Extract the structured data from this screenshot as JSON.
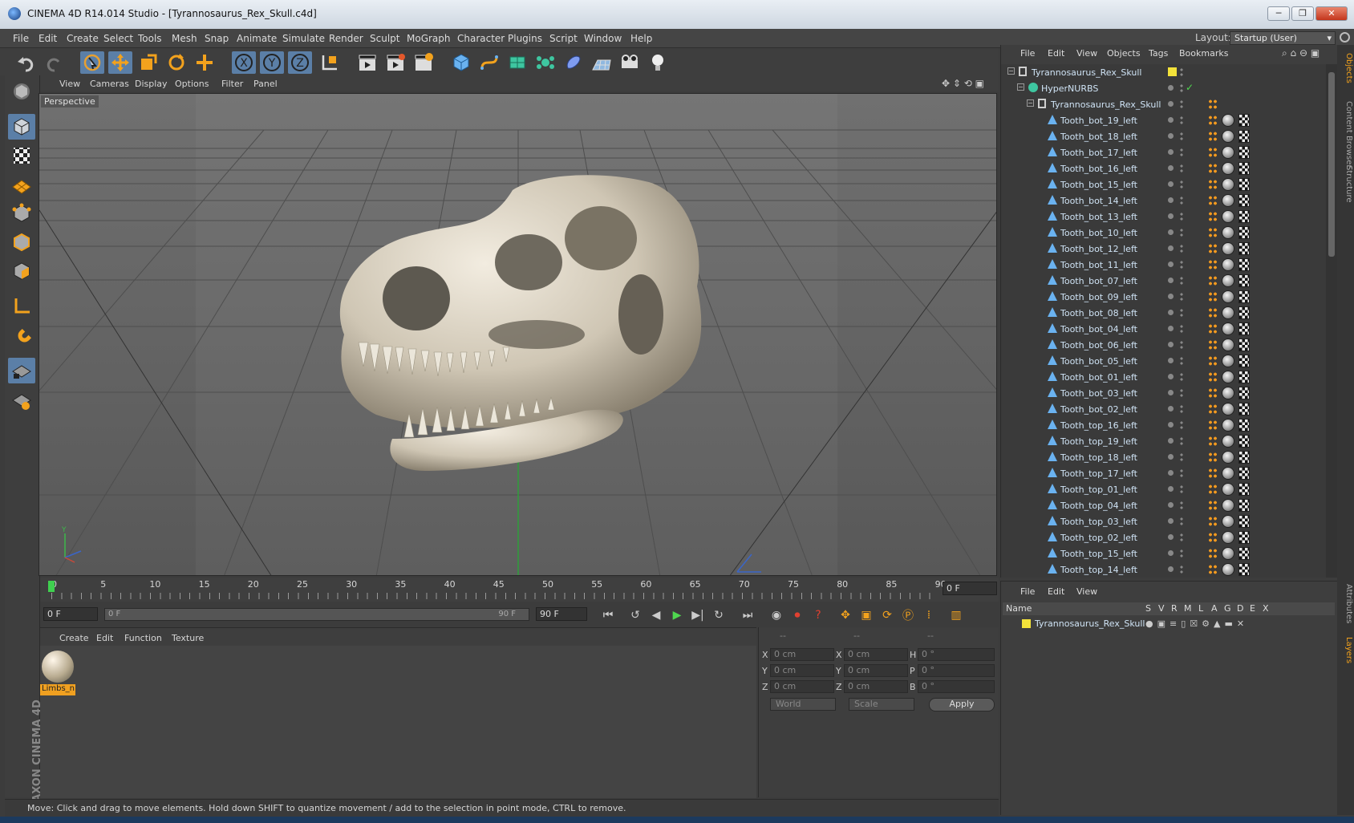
{
  "titlebar": {
    "title": "CINEMA 4D R14.014 Studio - [Tyrannosaurus_Rex_Skull.c4d]"
  },
  "menubar": {
    "items": [
      "File",
      "Edit",
      "Create",
      "Select",
      "Tools",
      "Mesh",
      "Snap",
      "Animate",
      "Simulate",
      "Render",
      "Sculpt",
      "MoGraph",
      "Character",
      "Plugins",
      "Script",
      "Window",
      "Help"
    ],
    "layout_label": "Layout:",
    "layout_value": "Startup (User)"
  },
  "viewport": {
    "menu": [
      "View",
      "Cameras",
      "Display",
      "Options",
      "Filter",
      "Panel"
    ],
    "label": "Perspective"
  },
  "timeline": {
    "ticks": [
      "0",
      "5",
      "10",
      "15",
      "20",
      "25",
      "30",
      "35",
      "40",
      "45",
      "50",
      "55",
      "60",
      "65",
      "70",
      "75",
      "80",
      "85",
      "90"
    ],
    "current_frame": "0 F"
  },
  "transport": {
    "start_field": "0 F",
    "slider_left": "0 F",
    "slider_right": "90 F",
    "end_field": "90 F"
  },
  "material_manager": {
    "menu": [
      "Create",
      "Edit",
      "Function",
      "Texture"
    ],
    "material_name": "Limbs_n"
  },
  "coordinates": {
    "headers": [
      "--",
      "--",
      "--"
    ],
    "rows": [
      {
        "a": "X",
        "av": "0 cm",
        "b": "X",
        "bv": "0 cm",
        "c": "H",
        "cv": "0 °"
      },
      {
        "a": "Y",
        "av": "0 cm",
        "b": "Y",
        "bv": "0 cm",
        "c": "P",
        "cv": "0 °"
      },
      {
        "a": "Z",
        "av": "0 cm",
        "b": "Z",
        "bv": "0 cm",
        "c": "B",
        "cv": "0 °"
      }
    ],
    "mode": "World",
    "size_mode": "Scale",
    "apply": "Apply"
  },
  "status": {
    "text": "Move: Click and drag to move elements. Hold down SHIFT to quantize movement / add to the selection in point mode, CTRL to remove."
  },
  "object_manager": {
    "menu": [
      "File",
      "Edit",
      "View",
      "Objects",
      "Tags",
      "Bookmarks"
    ],
    "objects": [
      {
        "name": "Tyrannosaurus_Rex_Skull",
        "indent": 0,
        "kind": "null"
      },
      {
        "name": "HyperNURBS",
        "indent": 1,
        "kind": "nurbs"
      },
      {
        "name": "Tyrannosaurus_Rex_Skull",
        "indent": 2,
        "kind": "null"
      },
      {
        "name": "Tooth_bot_19_left",
        "indent": 3,
        "kind": "poly"
      },
      {
        "name": "Tooth_bot_18_left",
        "indent": 3,
        "kind": "poly"
      },
      {
        "name": "Tooth_bot_17_left",
        "indent": 3,
        "kind": "poly"
      },
      {
        "name": "Tooth_bot_16_left",
        "indent": 3,
        "kind": "poly"
      },
      {
        "name": "Tooth_bot_15_left",
        "indent": 3,
        "kind": "poly"
      },
      {
        "name": "Tooth_bot_14_left",
        "indent": 3,
        "kind": "poly"
      },
      {
        "name": "Tooth_bot_13_left",
        "indent": 3,
        "kind": "poly"
      },
      {
        "name": "Tooth_bot_10_left",
        "indent": 3,
        "kind": "poly"
      },
      {
        "name": "Tooth_bot_12_left",
        "indent": 3,
        "kind": "poly"
      },
      {
        "name": "Tooth_bot_11_left",
        "indent": 3,
        "kind": "poly"
      },
      {
        "name": "Tooth_bot_07_left",
        "indent": 3,
        "kind": "poly"
      },
      {
        "name": "Tooth_bot_09_left",
        "indent": 3,
        "kind": "poly"
      },
      {
        "name": "Tooth_bot_08_left",
        "indent": 3,
        "kind": "poly"
      },
      {
        "name": "Tooth_bot_04_left",
        "indent": 3,
        "kind": "poly"
      },
      {
        "name": "Tooth_bot_06_left",
        "indent": 3,
        "kind": "poly"
      },
      {
        "name": "Tooth_bot_05_left",
        "indent": 3,
        "kind": "poly"
      },
      {
        "name": "Tooth_bot_01_left",
        "indent": 3,
        "kind": "poly"
      },
      {
        "name": "Tooth_bot_03_left",
        "indent": 3,
        "kind": "poly"
      },
      {
        "name": "Tooth_bot_02_left",
        "indent": 3,
        "kind": "poly"
      },
      {
        "name": "Tooth_top_16_left",
        "indent": 3,
        "kind": "poly"
      },
      {
        "name": "Tooth_top_19_left",
        "indent": 3,
        "kind": "poly"
      },
      {
        "name": "Tooth_top_18_left",
        "indent": 3,
        "kind": "poly"
      },
      {
        "name": "Tooth_top_17_left",
        "indent": 3,
        "kind": "poly"
      },
      {
        "name": "Tooth_top_01_left",
        "indent": 3,
        "kind": "poly"
      },
      {
        "name": "Tooth_top_04_left",
        "indent": 3,
        "kind": "poly"
      },
      {
        "name": "Tooth_top_03_left",
        "indent": 3,
        "kind": "poly"
      },
      {
        "name": "Tooth_top_02_left",
        "indent": 3,
        "kind": "poly"
      },
      {
        "name": "Tooth_top_15_left",
        "indent": 3,
        "kind": "poly"
      },
      {
        "name": "Tooth_top_14_left",
        "indent": 3,
        "kind": "poly"
      }
    ]
  },
  "layer_manager": {
    "menu": [
      "File",
      "Edit",
      "View"
    ],
    "columns": [
      "Name",
      "S",
      "V",
      "R",
      "M",
      "L",
      "A",
      "G",
      "D",
      "E",
      "X"
    ],
    "layer_name": "Tyrannosaurus_Rex_Skull"
  },
  "side_tabs": [
    "Objects",
    "Content Browser",
    "Structure",
    "Attributes",
    "Layers"
  ],
  "branding": {
    "maxon": "MAXON CINEMA 4D"
  },
  "colors": {
    "accent_blue": "#5b7fa7",
    "material_label": "#f0a020",
    "layer_color": "#f3e23a",
    "tag_orange": "#f39a1f"
  }
}
